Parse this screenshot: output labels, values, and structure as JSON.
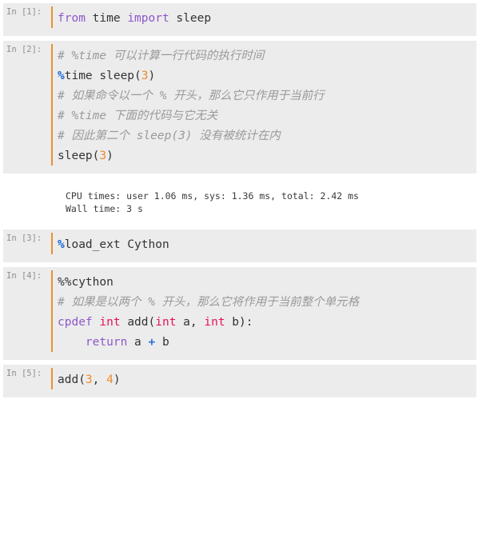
{
  "notebook": {
    "cells": [
      {
        "type": "input",
        "prompt": "In [1]:",
        "lines": [
          [
            {
              "t": "from ",
              "c": "kw"
            },
            {
              "t": "time ",
              "c": "plain"
            },
            {
              "t": "import ",
              "c": "kw"
            },
            {
              "t": "sleep",
              "c": "plain"
            }
          ]
        ]
      },
      {
        "type": "input",
        "prompt": "In [2]:",
        "lines": [
          [
            {
              "t": "# %time 可以计算一行代码的执行时间",
              "c": "cmt"
            }
          ],
          [
            {
              "t": "%",
              "c": "magic"
            },
            {
              "t": "time sleep(",
              "c": "plain"
            },
            {
              "t": "3",
              "c": "num"
            },
            {
              "t": ")",
              "c": "plain"
            }
          ],
          [
            {
              "t": "# 如果命令以一个 % 开头，那么它只作用于当前行",
              "c": "cmt"
            }
          ],
          [
            {
              "t": "# %time 下面的代码与它无关",
              "c": "cmt"
            }
          ],
          [
            {
              "t": "# 因此第二个 sleep(3) 没有被统计在内",
              "c": "cmt"
            }
          ],
          [
            {
              "t": "sleep(",
              "c": "plain"
            },
            {
              "t": "3",
              "c": "num"
            },
            {
              "t": ")",
              "c": "plain"
            }
          ]
        ]
      },
      {
        "type": "output",
        "lines": [
          "CPU times: user 1.06 ms, sys: 1.36 ms, total: 2.42 ms",
          "Wall time: 3 s"
        ]
      },
      {
        "type": "input",
        "prompt": "In [3]:",
        "lines": [
          [
            {
              "t": "%",
              "c": "magic"
            },
            {
              "t": "load_ext Cython",
              "c": "plain"
            }
          ]
        ]
      },
      {
        "type": "input",
        "prompt": "In [4]:",
        "lines": [
          [
            {
              "t": "%%cython",
              "c": "plain"
            }
          ],
          [
            {
              "t": "# 如果是以两个 % 开头，那么它将作用于当前整个单元格",
              "c": "cmt"
            }
          ],
          [
            {
              "t": "cpdef ",
              "c": "kw"
            },
            {
              "t": "int ",
              "c": "type"
            },
            {
              "t": "add(",
              "c": "plain"
            },
            {
              "t": "int ",
              "c": "type"
            },
            {
              "t": "a, ",
              "c": "plain"
            },
            {
              "t": "int ",
              "c": "type"
            },
            {
              "t": "b):",
              "c": "plain"
            }
          ],
          [
            {
              "t": "    ",
              "c": "plain"
            },
            {
              "t": "return ",
              "c": "kw"
            },
            {
              "t": "a ",
              "c": "plain"
            },
            {
              "t": "+",
              "c": "op"
            },
            {
              "t": " b",
              "c": "plain"
            }
          ]
        ]
      },
      {
        "type": "input",
        "prompt": "In [5]:",
        "lines": [
          [
            {
              "t": "add(",
              "c": "plain"
            },
            {
              "t": "3",
              "c": "num"
            },
            {
              "t": ", ",
              "c": "plain"
            },
            {
              "t": "4",
              "c": "num"
            },
            {
              "t": ")",
              "c": "plain"
            }
          ]
        ]
      }
    ]
  },
  "theme": {
    "cell_background": "#ececec",
    "output_background": "#ffffff",
    "prompt_color": "#8e8e8e",
    "cursor_bar_color": "#e8922e",
    "keyword_color": "#8d58c9",
    "type_color": "#e6125b",
    "number_color": "#f08a2c",
    "magic_color": "#1464d6",
    "operator_color": "#2a6fdb",
    "comment_color": "#9a9a9a",
    "text_color": "#333333"
  }
}
